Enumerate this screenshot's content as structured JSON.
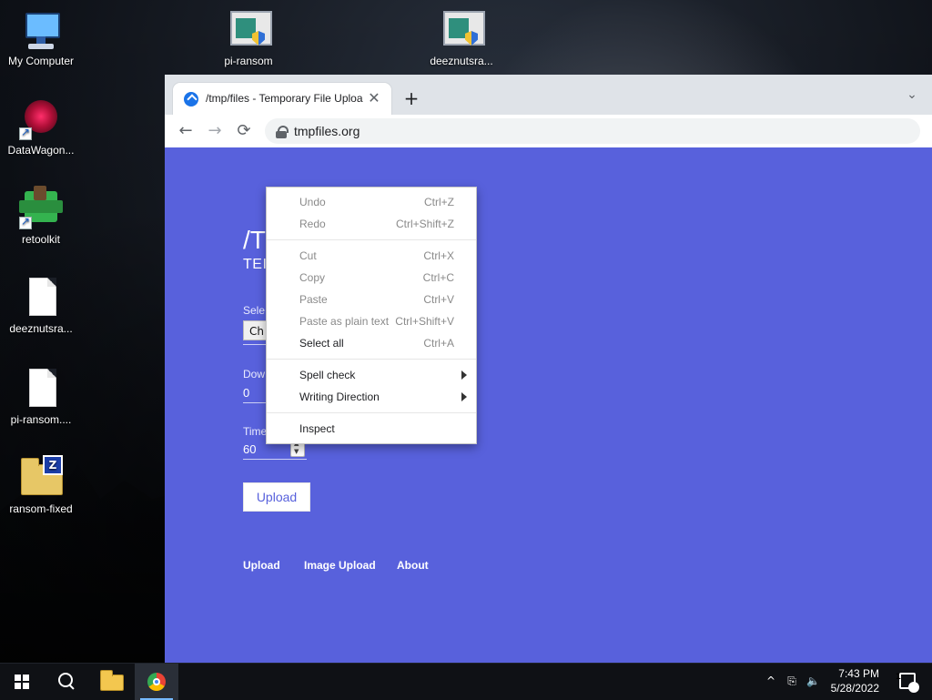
{
  "desktop": {
    "icons": [
      {
        "label": "My Computer"
      },
      {
        "label": "DataWagon..."
      },
      {
        "label": "retoolkit"
      },
      {
        "label": "deeznutsra..."
      },
      {
        "label": "pi-ransom...."
      },
      {
        "label": "ransom-fixed"
      },
      {
        "label": "pi-ransom"
      },
      {
        "label": "deeznutsra..."
      }
    ]
  },
  "browser": {
    "tab": {
      "title": "/tmp/files - Temporary File Uploa",
      "close_glyph": "✕"
    },
    "new_tab_glyph": "+",
    "tab_dropdown_glyph": "⌄",
    "nav": {
      "back_glyph": "←",
      "forward_glyph": "→",
      "reload_glyph": "⟳"
    },
    "address": {
      "url": "tmpfiles.org"
    }
  },
  "page": {
    "title_partial": "/T",
    "subtitle_partial": "TEI",
    "labels": {
      "select": "Sele",
      "downloads": "Dow",
      "timeout": "Time"
    },
    "choose_button_partial": "Ch",
    "downloads_value": "0",
    "timeout_value": "60",
    "upload_button": "Upload",
    "footer_links": [
      "Upload",
      "Image Upload",
      "About"
    ]
  },
  "context_menu": {
    "groups": [
      [
        {
          "label": "Undo",
          "shortcut": "Ctrl+Z",
          "disabled": true
        },
        {
          "label": "Redo",
          "shortcut": "Ctrl+Shift+Z",
          "disabled": true
        }
      ],
      [
        {
          "label": "Cut",
          "shortcut": "Ctrl+X",
          "disabled": true
        },
        {
          "label": "Copy",
          "shortcut": "Ctrl+C",
          "disabled": true
        },
        {
          "label": "Paste",
          "shortcut": "Ctrl+V",
          "disabled": true
        },
        {
          "label": "Paste as plain text",
          "shortcut": "Ctrl+Shift+V",
          "disabled": true
        },
        {
          "label": "Select all",
          "shortcut": "Ctrl+A",
          "disabled": false
        }
      ],
      [
        {
          "label": "Spell check",
          "shortcut": "",
          "disabled": false,
          "submenu": true
        },
        {
          "label": "Writing Direction",
          "shortcut": "",
          "disabled": false,
          "submenu": true
        }
      ],
      [
        {
          "label": "Inspect",
          "shortcut": "",
          "disabled": false
        }
      ]
    ]
  },
  "taskbar": {
    "clock": {
      "time": "7:43 PM",
      "date": "5/28/2022"
    },
    "tray": {
      "chevron_glyph": "^",
      "network_glyph": "⎘",
      "volume_glyph": "🔈"
    },
    "notification_count": "1"
  },
  "colors": {
    "page_background": "#5861DC",
    "taskbar": "#0F1115",
    "menu_text": "#202124",
    "menu_disabled": "#8A8A8A"
  }
}
